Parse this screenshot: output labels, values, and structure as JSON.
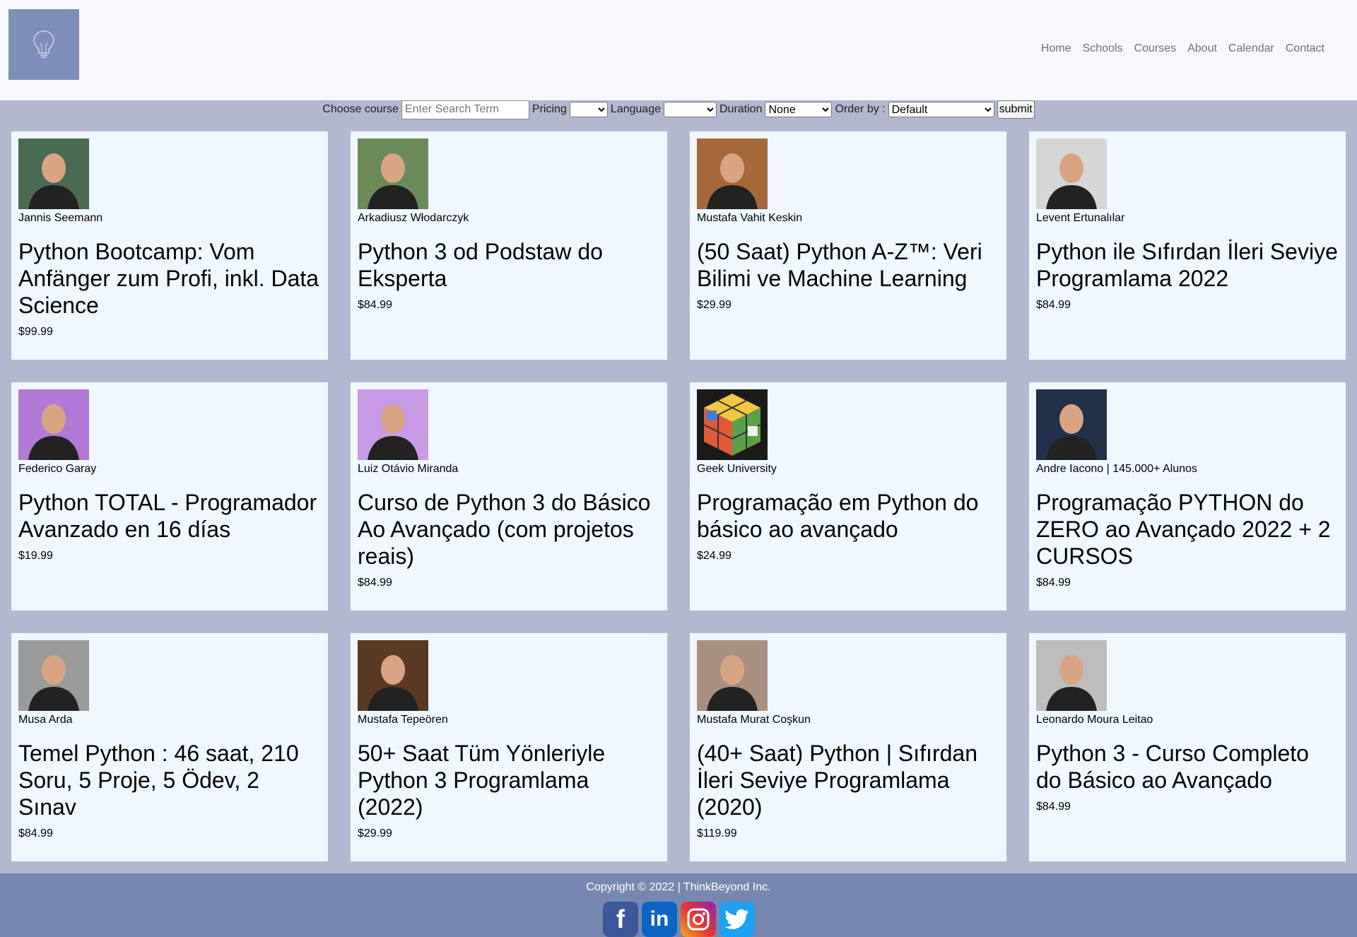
{
  "nav": {
    "items": [
      "Home",
      "Schools",
      "Courses",
      "About",
      "Calendar",
      "Contact"
    ]
  },
  "search": {
    "choose_label": "Choose course",
    "placeholder": "Enter Search Term",
    "pricing_label": "Pricing",
    "pricing_value": "",
    "language_label": "Language",
    "language_value": "",
    "duration_label": "Duration",
    "duration_value": "None",
    "order_label": "Order by :",
    "order_value": "Default",
    "submit_label": "submit"
  },
  "courses": [
    {
      "instructor": "Jannis Seemann",
      "title": "Python Bootcamp: Vom Anfänger zum Profi, inkl. Data Science",
      "price": "$99.99",
      "avatar_color": "#4a6a52"
    },
    {
      "instructor": "Arkadiusz Włodarczyk",
      "title": "Python 3 od Podstaw do Eksperta",
      "price": "$84.99",
      "avatar_color": "#6b8a5a"
    },
    {
      "instructor": "Mustafa Vahit Keskin",
      "title": "(50 Saat) Python A-Z™: Veri Bilimi ve Machine Learning",
      "price": "$29.99",
      "avatar_color": "#a5683a"
    },
    {
      "instructor": "Levent Ertunalılar",
      "title": "Python ile Sıfırdan İleri Seviye Programlama 2022",
      "price": "$84.99",
      "avatar_color": "#d6d6d6"
    },
    {
      "instructor": "Federico Garay",
      "title": "Python TOTAL - Programador Avanzado en 16 días",
      "price": "$19.99",
      "avatar_color": "#b07ad6"
    },
    {
      "instructor": "Luiz Otávio Miranda",
      "title": "Curso de Python 3 do Básico Ao Avançado (com projetos reais)",
      "price": "$84.99",
      "avatar_color": "#c89be6"
    },
    {
      "instructor": "Geek University",
      "title": "Programação em Python do básico ao avançado",
      "price": "$24.99",
      "avatar_color": "#1a1a1a"
    },
    {
      "instructor": "Andre Iacono | 145.000+ Alunos",
      "title": "Programação PYTHON do ZERO ao Avançado 2022 + 2 CURSOS",
      "price": "$84.99",
      "avatar_color": "#22304a"
    },
    {
      "instructor": "Musa Arda",
      "title": "Temel Python : 46 saat, 210 Soru, 5 Proje, 5 Ödev, 2 Sınav",
      "price": "$84.99",
      "avatar_color": "#9a9a9a"
    },
    {
      "instructor": "Mustafa Tepeören",
      "title": "50+ Saat Tüm Yönleriyle Python 3 Programlama (2022)",
      "price": "$29.99",
      "avatar_color": "#5a3a22"
    },
    {
      "instructor": "Mustafa Murat Coşkun",
      "title": "(40+ Saat) Python | Sıfırdan İleri Seviye Programlama (2020)",
      "price": "$119.99",
      "avatar_color": "#a89080"
    },
    {
      "instructor": "Leonardo Moura Leitao",
      "title": "Python 3 - Curso Completo do Básico ao Avançado",
      "price": "$84.99",
      "avatar_color": "#bdbdbd"
    }
  ],
  "footer": {
    "copyright": "Copyright © 2022 | ThinkBeyond Inc."
  },
  "icons": {
    "logo": "lightbulb-icon",
    "socials": [
      "facebook-icon",
      "linkedin-icon",
      "instagram-icon",
      "twitter-icon"
    ]
  },
  "colors": {
    "header_bg": "#f7f8fb",
    "page_bg": "#b3b8d0",
    "card_bg": "#f0f7ff",
    "footer_bg": "#7688b0",
    "logo_bg": "#7d8fb6"
  }
}
